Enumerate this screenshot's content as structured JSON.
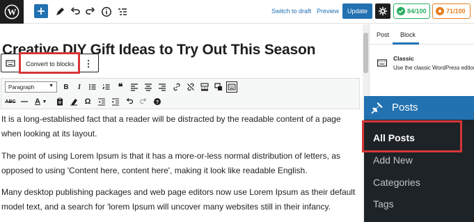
{
  "topbar": {
    "logo_icon": "wordpress-logo-icon",
    "add_block_icon": "plus-icon",
    "tools_icon": "pencil-icon",
    "undo_icon": "undo-icon",
    "redo_icon": "redo-icon",
    "details_icon": "info-icon",
    "outline_icon": "list-view-icon",
    "switch_to_draft": "Switch to draft",
    "preview": "Preview",
    "update": "Update",
    "settings_icon": "settings-icon",
    "seo_score": "84/100",
    "readability_score": "71/100"
  },
  "editor": {
    "post_title": "Creative DIY Gift Ideas to Try Out This Season",
    "block_toolbar": {
      "block_icon": "keyboard-icon",
      "convert_to_blocks": "Convert to blocks",
      "more_options": "⋮"
    },
    "classic_toolbar": {
      "format_select_value": "Paragraph",
      "row1": [
        "bold-icon",
        "italic-icon",
        "bullet-list-icon",
        "numbered-list-icon",
        "blockquote-icon",
        "align-left-icon",
        "align-center-icon",
        "align-right-icon",
        "link-icon",
        "unlink-icon",
        "read-more-icon",
        "fullscreen-icon",
        "toolbar-toggle-icon"
      ],
      "row2": [
        "strikethrough-icon",
        "horizontal-line-icon",
        "text-color-icon",
        "color-dropdown-icon",
        "paste-text-icon",
        "clear-formatting-icon",
        "special-character-icon",
        "outdent-icon",
        "indent-icon",
        "undo-icon",
        "redo-icon",
        "help-icon"
      ]
    },
    "paragraphs": [
      "It is a long-established fact that a reader will be distracted by the readable content of a page when looking at its layout.",
      "The point of using Lorem Ipsum is that it has a more-or-less normal distribution of letters, as opposed to using 'Content here, content here', making it look like readable English.",
      "Many desktop publishing packages and web page editors now use Lorem Ipsum as their default model text, and a search for 'lorem Ipsum will uncover many websites still in their infancy."
    ]
  },
  "sidebar": {
    "tabs": [
      {
        "label": "Post"
      },
      {
        "label": "Block"
      }
    ],
    "active_tab": "Block",
    "block_card": {
      "icon": "keyboard-icon",
      "title": "Classic",
      "description": "Use the classic WordPress editor"
    }
  },
  "admin_menu": {
    "header_icon": "pushpin-icon",
    "header_label": "Posts",
    "items": [
      {
        "label": "All Posts"
      },
      {
        "label": "Add New"
      },
      {
        "label": "Categories"
      },
      {
        "label": "Tags"
      }
    ],
    "current_item": "All Posts"
  },
  "colors": {
    "accent": "#2271b1",
    "highlight": "#d63638",
    "admin_menu_bg": "#1d2327",
    "seo_green": "#27ae60",
    "readability_orange": "#e67e22"
  }
}
